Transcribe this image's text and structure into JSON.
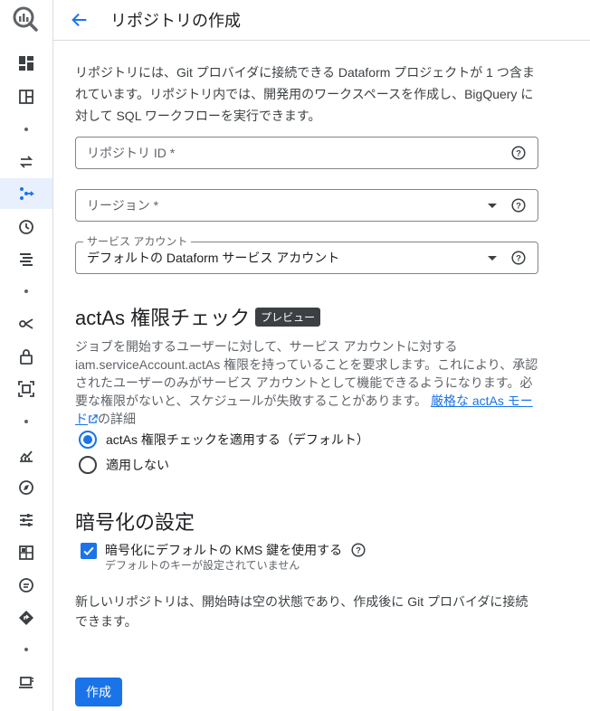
{
  "header": {
    "title": "リポジトリの作成"
  },
  "rail": {
    "icons": [
      "dashboard-icon",
      "grid-panel-icon",
      "transfer-icon",
      "pipeline-icon",
      "history-icon",
      "list-icon",
      "graph-icon",
      "lock-icon",
      "scan-icon",
      "chart-icon",
      "compass-icon",
      "tune-icon",
      "table-icon",
      "chat-icon",
      "diamond-icon",
      "device-icon"
    ],
    "accent": "#1a73e8"
  },
  "intro": "リポジトリには、Git プロバイダに接続できる Dataform プロジェクトが 1 つ含まれています。リポジトリ内では、開発用のワークスペースを作成し、BigQuery に対して SQL ワークフローを実行できます。",
  "form": {
    "repo_id_placeholder": "リポジトリ ID *",
    "region_placeholder": "リージョン *",
    "service_account_label": "サービス アカウント",
    "service_account_value": "デフォルトの Dataform サービス アカウント"
  },
  "actas": {
    "title": "actAs 権限チェック",
    "badge": "プレビュー",
    "description": "ジョブを開始するユーザーに対して、サービス アカウントに対する iam.serviceAccount.actAs 権限を持っていることを要求します。これにより、承認されたユーザーのみがサービス アカウントとして機能できるようになります。必要な権限がないと、スケジュールが失敗することがあります。",
    "link": "厳格な actAs モード",
    "link_suffix": "の詳細",
    "option_apply": "actAs 権限チェックを適用する（デフォルト）",
    "option_none": "適用しない"
  },
  "encryption": {
    "title": "暗号化の設定",
    "checkbox_label": "暗号化にデフォルトの KMS 鍵を使用する",
    "checkbox_sub": "デフォルトのキーが設定されていません"
  },
  "note": "新しいリポジトリは、開始時は空の状態であり、作成後に Git プロバイダに接続できます。",
  "create_label": "作成"
}
